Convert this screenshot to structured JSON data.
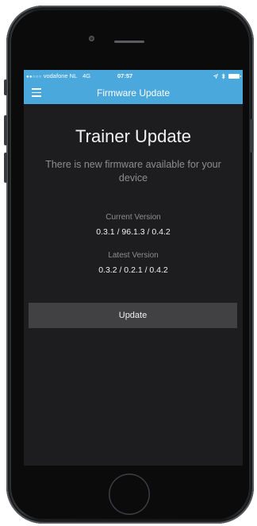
{
  "status_bar": {
    "signal_dots": "●●○○○",
    "carrier": "vodafone NL",
    "network": "4G",
    "time": "07:57",
    "location_icon": "location-arrow-icon",
    "bluetooth_icon": "bluetooth-icon",
    "battery_icon": "battery-icon"
  },
  "nav": {
    "menu_icon": "hamburger-menu-icon",
    "title": "Firmware Update"
  },
  "main": {
    "title": "Trainer Update",
    "subtitle": "There is new firmware available for your device",
    "current_version_label": "Current Version",
    "current_version_value": "0.3.1 / 96.1.3 / 0.4.2",
    "latest_version_label": "Latest Version",
    "latest_version_value": "0.3.2 / 0.2.1 / 0.4.2",
    "update_button_label": "Update"
  },
  "colors": {
    "accent": "#4aa8dc",
    "background": "#1d1d1f",
    "button": "#414143"
  }
}
